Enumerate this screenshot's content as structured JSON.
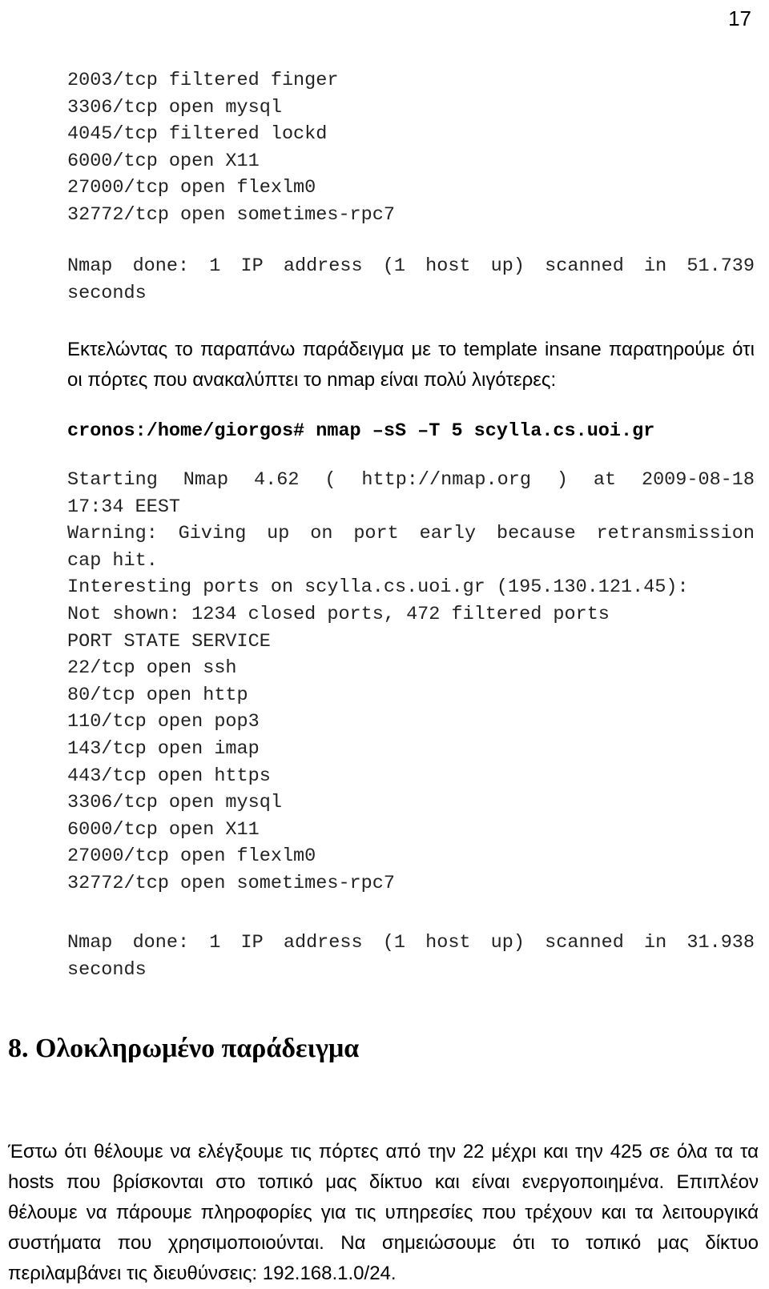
{
  "page": {
    "number": "17"
  },
  "block_ports_top": {
    "lines": [
      "2003/tcp filtered finger",
      "3306/tcp open mysql",
      "4045/tcp filtered lockd",
      "6000/tcp open X11",
      "27000/tcp open flexlm0",
      "32772/tcp open sometimes-rpc7"
    ]
  },
  "block_done_top": {
    "line1": "Nmap done: 1 IP address (1 host up) scanned in 51.739",
    "line2": "seconds"
  },
  "paragraph_intro": {
    "text": "Εκτελώντας το παραπάνω παράδειγμα με το template insane παρατηρούμε ότι οι πόρτες που ανακαλύπτει το nmap είναι πολύ λιγότερες:"
  },
  "command_line": {
    "text": "cronos:/home/giorgos# nmap –sS –T 5 scylla.cs.uoi.gr"
  },
  "block_scan_output": {
    "lines": [
      "Starting Nmap 4.62 ( http://nmap.org ) at 2009-08-18",
      "17:34 EEST",
      "Warning: Giving up on port early because retransmission",
      "cap hit.",
      "Interesting ports on scylla.cs.uoi.gr (195.130.121.45):",
      "Not shown: 1234 closed ports, 472 filtered ports",
      "PORT STATE SERVICE",
      "22/tcp open ssh",
      "80/tcp open http",
      "110/tcp open pop3",
      "143/tcp open imap",
      "443/tcp open https",
      "3306/tcp open mysql",
      "6000/tcp open X11",
      "27000/tcp open flexlm0",
      "32772/tcp open sometimes-rpc7"
    ]
  },
  "block_done_bottom": {
    "line1": "Nmap done: 1 IP address (1 host up) scanned in 31.938",
    "line2": "seconds"
  },
  "section_heading": {
    "text": "8. Ολοκληρωμένο παράδειγμα"
  },
  "paragraph_outro": {
    "text": "Έστω ότι θέλουμε να ελέγξουμε τις πόρτες από την 22 μέχρι και την 425 σε όλα τα τα hosts που βρίσκονται στο τοπικό μας δίκτυο και είναι ενεργοποιημένα. Επιπλέον θέλουμε να πάρουμε πληροφορίες για τις υπηρεσίες που τρέχουν και τα λειτουργικά συστήματα που χρησιμοποιούνται. Να σημειώσουμε ότι το τοπικό μας δίκτυο περιλαμβάνει τις διευθύνσεις: 192.168.1.0/24."
  }
}
